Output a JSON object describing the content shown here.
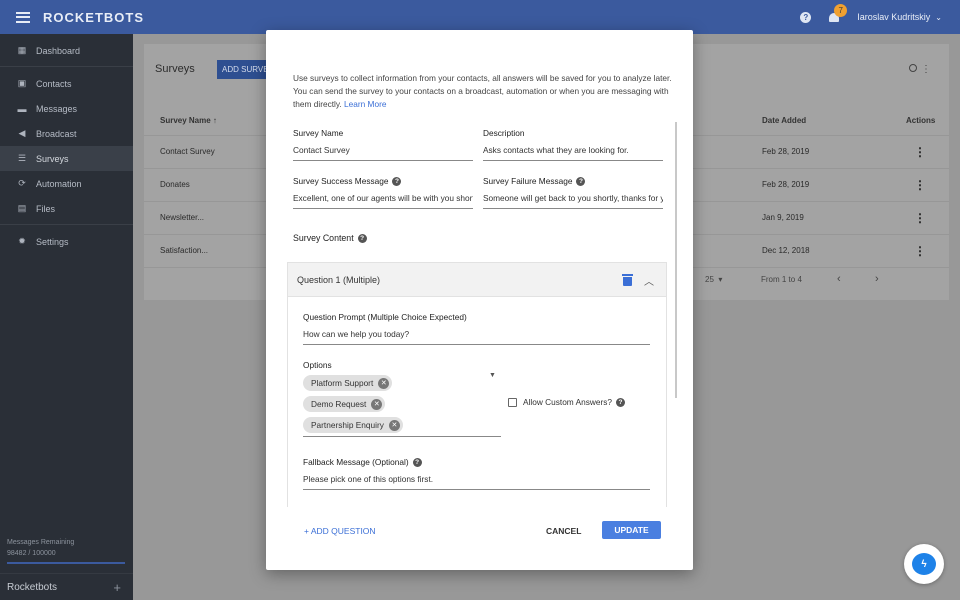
{
  "topbar": {
    "brand": "ROCKETBOTS",
    "help_glyph": "?",
    "notification_count": "7",
    "user_name": "Iaroslav Kudritskiy",
    "user_chevron": "⌄"
  },
  "sidebar": {
    "items": [
      {
        "label": "Dashboard",
        "icon": "dashboard-icon"
      },
      {
        "label": "Contacts",
        "icon": "contacts-icon"
      },
      {
        "label": "Messages",
        "icon": "messages-icon"
      },
      {
        "label": "Broadcast",
        "icon": "broadcast-icon"
      },
      {
        "label": "Surveys",
        "icon": "surveys-icon"
      },
      {
        "label": "Automation",
        "icon": "automation-icon"
      },
      {
        "label": "Files",
        "icon": "files-icon"
      },
      {
        "label": "Settings",
        "icon": "settings-icon"
      }
    ],
    "remaining_label": "Messages Remaining",
    "remaining_value": "98482 / 100000",
    "workspace_name": "Rocketbots",
    "workspace_plus": "+"
  },
  "background": {
    "title": "Surveys",
    "add_button": "ADD SURVEY",
    "columns": {
      "name": "Survey Name ↑",
      "date": "Date Added",
      "actions": "Actions"
    },
    "rows": [
      {
        "name": "Contact Survey",
        "date": "Feb 28, 2019"
      },
      {
        "name": "Donates",
        "date": "Feb 28, 2019"
      },
      {
        "name": "Newsletter...",
        "date": "Jan 9, 2019"
      },
      {
        "name": "Satisfaction...",
        "date": "Dec 12, 2018"
      }
    ],
    "rows_per_page": "25",
    "range": "From 1 to 4",
    "prev": "‹",
    "next": "›"
  },
  "modal": {
    "intro": "Use surveys to collect information from your contacts, all answers will be saved for you to analyze later. You can send the survey to your contacts on a broadcast, automation or when you are messaging with them directly. ",
    "learn_more": "Learn More",
    "survey_name_label": "Survey Name",
    "survey_name_value": "Contact Survey",
    "description_label": "Description",
    "description_value": "Asks contacts what they are looking for.",
    "success_label": "Survey Success Message",
    "success_value": "Excellent, one of our agents will be with you shortly",
    "failure_label": "Survey Failure Message",
    "failure_value": "Someone will get back to you shortly, thanks for your patience",
    "content_label": "Survey Content",
    "question": {
      "header": "Question 1 (Multiple)",
      "prompt_label": "Question Prompt (Multiple Choice Expected)",
      "prompt_value": "How can we help you today?",
      "options_label": "Options",
      "options": [
        "Platform Support",
        "Demo Request",
        "Partnership Enquiry"
      ],
      "allow_custom_label": "Allow Custom Answers?",
      "fallback_label": "Fallback Message (Optional)",
      "fallback_value": "Please pick one of this options first."
    },
    "add_question": "+ ADD QUESTION",
    "cancel": "CANCEL",
    "update": "UPDATE"
  },
  "colors": {
    "topbar": "#3b5a9e",
    "sidebar": "#2a2f37",
    "accent": "#4a7fe0",
    "link": "#3b6fd6",
    "badge": "#f0a030"
  }
}
